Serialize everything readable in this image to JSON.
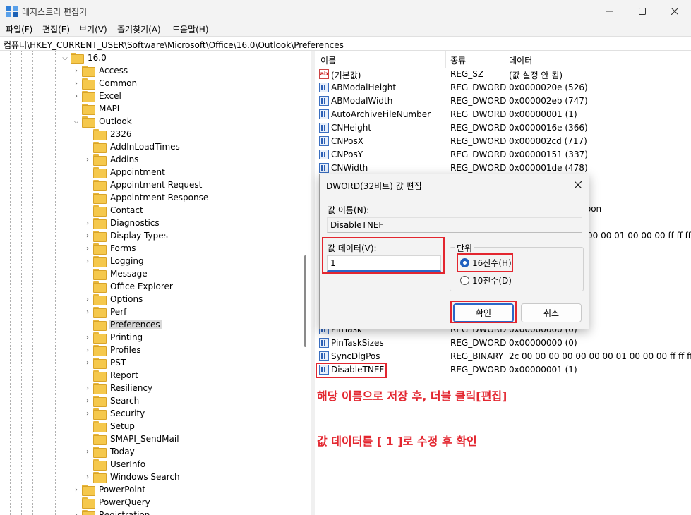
{
  "window": {
    "title": "레지스트리 편집기"
  },
  "menu": [
    "파일(F)",
    "편집(E)",
    "보기(V)",
    "즐겨찾기(A)",
    "도움말(H)"
  ],
  "address": "컴퓨터\\HKEY_CURRENT_USER\\Software\\Microsoft\\Office\\16.0\\Outlook\\Preferences",
  "tree": {
    "root": "16.0",
    "office_children": [
      "Access",
      "Common",
      "Excel",
      "MAPI",
      "Outlook"
    ],
    "outlook_children": [
      "2326",
      "AddInLoadTimes",
      "Addins",
      "Appointment",
      "Appointment Request",
      "Appointment Response",
      "Contact",
      "Diagnostics",
      "Display Types",
      "Forms",
      "Logging",
      "Message",
      "Office Explorer",
      "Options",
      "Perf",
      "Preferences",
      "Printing",
      "Profiles",
      "PST",
      "Report",
      "Resiliency",
      "Search",
      "Security",
      "Setup",
      "SMAPI_SendMail",
      "Today",
      "UserInfo",
      "Windows Search"
    ],
    "after": [
      "PowerPoint",
      "PowerQuery",
      "Registration"
    ],
    "selected": "Preferences"
  },
  "columns": {
    "name": "이름",
    "type": "종류",
    "data": "데이터"
  },
  "values_top": [
    {
      "name": "(기본값)",
      "type": "REG_SZ",
      "data": "(값 설정 안 됨)",
      "icon": "string-value-icon"
    },
    {
      "name": "ABModalHeight",
      "type": "REG_DWORD",
      "data": "0x0000020e (526)",
      "icon": "binary-value-icon"
    },
    {
      "name": "ABModalWidth",
      "type": "REG_DWORD",
      "data": "0x000002eb (747)",
      "icon": "binary-value-icon"
    },
    {
      "name": "AutoArchiveFileNumber",
      "type": "REG_DWORD",
      "data": "0x00000001 (1)",
      "icon": "binary-value-icon"
    },
    {
      "name": "CNHeight",
      "type": "REG_DWORD",
      "data": "0x0000016e (366)",
      "icon": "binary-value-icon"
    },
    {
      "name": "CNPosX",
      "type": "REG_DWORD",
      "data": "0x000002cd (717)",
      "icon": "binary-value-icon"
    },
    {
      "name": "CNPosY",
      "type": "REG_DWORD",
      "data": "0x00000151 (337)",
      "icon": "binary-value-icon"
    },
    {
      "name": "CNWidth",
      "type": "REG_DWORD",
      "data": "0x000001de (478)",
      "icon": "binary-value-icon"
    }
  ],
  "values_partial": {
    "data_1": "gsoon",
    "data_2": "00 00 01 00 00 00 ff ff ff f"
  },
  "values_bottom": [
    {
      "name": "PinTask",
      "type": "REG_DWORD",
      "data": "0x00000000 (0)",
      "icon": "binary-value-icon"
    },
    {
      "name": "PinTaskSizes",
      "type": "REG_DWORD",
      "data": "0x00000000 (0)",
      "icon": "binary-value-icon"
    },
    {
      "name": "SyncDlgPos",
      "type": "REG_BINARY",
      "data": "2c 00 00 00 00 00 00 00 01 00 00 00 ff ff ff f",
      "icon": "binary-value-icon"
    },
    {
      "name": "DisableTNEF",
      "type": "REG_DWORD",
      "data": "0x00000001 (1)",
      "icon": "binary-value-icon"
    }
  ],
  "annotations": {
    "line1": "해당 이름으로 저장 후, 더블 클릭[편집]",
    "line2": "값 데이터를 [ 1 ]로 수정 후 확인"
  },
  "dialog": {
    "title": "DWORD(32비트) 값 편집",
    "name_label": "값 이름(N):",
    "name_value": "DisableTNEF",
    "data_label": "값 데이터(V):",
    "data_value": "1",
    "base_label": "단위",
    "hex_label": "16진수(H)",
    "dec_label": "10진수(D)",
    "selected_base": "hex",
    "ok_label": "확인",
    "cancel_label": "취소"
  },
  "colors": {
    "annotation": "#e3262f",
    "accent": "#1f5fbf"
  }
}
